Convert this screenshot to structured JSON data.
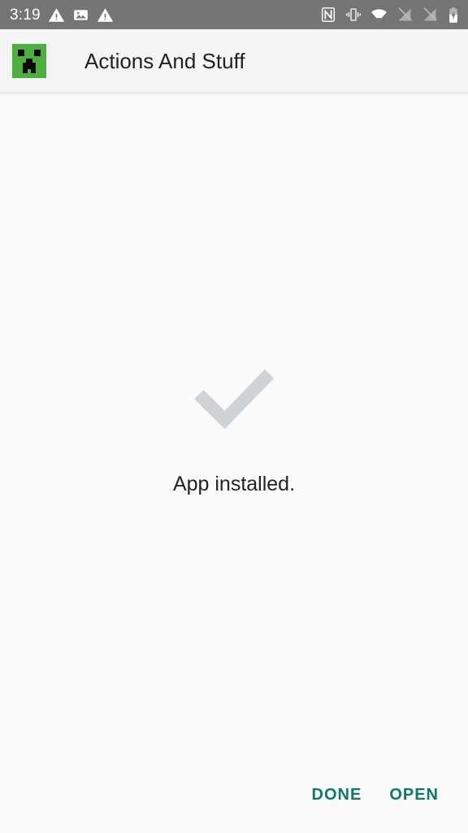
{
  "status_bar": {
    "clock": "3:19",
    "background_color": "#757575",
    "foreground_color": "#FFFFFF",
    "left_icons": [
      {
        "name": "warning-triangle-icon"
      },
      {
        "name": "image-photo-icon"
      },
      {
        "name": "warning-triangle-icon"
      }
    ],
    "right_icons": [
      {
        "name": "nfc-icon"
      },
      {
        "name": "vibrate-mode-icon"
      },
      {
        "name": "wifi-icon"
      },
      {
        "name": "signal-disabled-icon"
      },
      {
        "name": "signal-disabled-icon"
      },
      {
        "name": "battery-charging-icon"
      }
    ]
  },
  "app_bar": {
    "title": "Actions And Stuff",
    "background_color": "#F5F5F5",
    "title_color": "#212121",
    "app_icon": {
      "name": "creeper-app-icon",
      "background_color": "#4CAF3F",
      "feature_color": "#0B0B0B"
    }
  },
  "content": {
    "status_icon_name": "checkmark-icon",
    "status_icon_color": "#CFD3D6",
    "status_text": "App installed.",
    "background_color": "#FAFAFA"
  },
  "actions": {
    "accent_color": "#0E7A66",
    "buttons": [
      {
        "name": "done-button",
        "label": "DONE"
      },
      {
        "name": "open-button",
        "label": "OPEN"
      }
    ]
  }
}
